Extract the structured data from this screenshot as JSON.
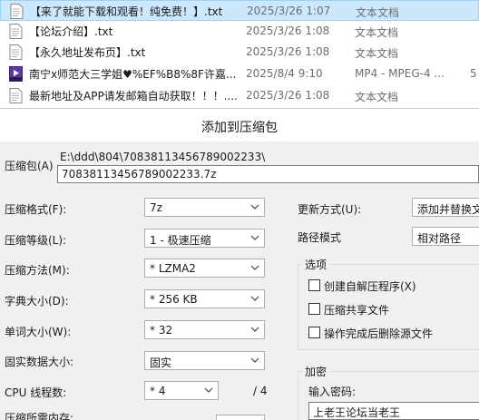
{
  "files": [
    {
      "name": "【来了就能下载和观看！纯免费！】.txt",
      "date": "2025/3/26 1:07",
      "type": "文本文档",
      "size": "",
      "icon": "text-file-icon",
      "selected": true
    },
    {
      "name": "【论坛介绍】.txt",
      "date": "2025/3/26 1:08",
      "type": "文本文档",
      "size": "",
      "icon": "text-file-icon",
      "selected": false
    },
    {
      "name": "【永久地址发布页】.txt",
      "date": "2025/3/26 1:08",
      "type": "文本文档",
      "size": "",
      "icon": "text-file-icon",
      "selected": false
    },
    {
      "name": "南宁x师范大三学姐♥%EF%B8%8F许嘉...",
      "date": "2025/8/4 9:10",
      "type": "MP4 - MPEG-4 ...",
      "size": "5",
      "icon": "mp4-file-icon",
      "selected": false
    },
    {
      "name": "最新地址及APP请发邮箱自动获取！！！....",
      "date": "2025/3/26 1:08",
      "type": "文本文档",
      "size": "",
      "icon": "text-file-icon",
      "selected": false
    }
  ],
  "dialog": {
    "title": "添加到压缩包",
    "archive_label": "压缩包(A)",
    "archive_path": "E:\\ddd\\804\\70838113456789002233\\",
    "archive_name": "70838113456789002233.7z",
    "format_label": "压缩格式(F):",
    "format_value": "7z",
    "level_label": "压缩等级(L):",
    "level_value": "1 - 极速压缩",
    "method_label": "压缩方法(M):",
    "method_value": "* LZMA2",
    "dict_label": "字典大小(D):",
    "dict_value": "* 256 KB",
    "word_label": "单词大小(W):",
    "word_value": "* 32",
    "solid_label": "固实数据大小:",
    "solid_value": "固实",
    "threads_label": "CPU 线程数:",
    "threads_value": "* 4",
    "threads_total": "/ 4",
    "memory_label": "压缩所需内存:",
    "update_label": "更新方式(U):",
    "update_value": "添加并替换文",
    "path_label": "路径模式",
    "path_value": "相对路径",
    "options_title": "选项",
    "opt_sfx": "创建自解压程序(X)",
    "opt_shared": "压缩共享文件",
    "opt_delete": "操作完成后删除源文件",
    "encrypt_title": "加密",
    "password_label": "输入密码:",
    "password_value": "上老王论坛当老王"
  }
}
